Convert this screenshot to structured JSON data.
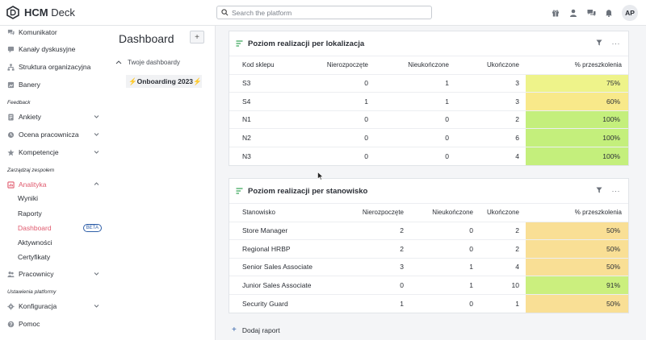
{
  "app": {
    "logo_text_bold": "HCM",
    "logo_text_rest": " Deck"
  },
  "search": {
    "placeholder": "Search the platform"
  },
  "user": {
    "initials": "AP"
  },
  "sidebar": {
    "top_items": [
      {
        "label": "Komunikator",
        "icon": "chat-icon"
      },
      {
        "label": "Kanały dyskusyjne",
        "icon": "channels-icon"
      },
      {
        "label": "Struktura organizacyjna",
        "icon": "org-structure-icon"
      },
      {
        "label": "Banery",
        "icon": "banner-icon"
      }
    ],
    "section_feedback": "Feedback",
    "feedback_items": [
      {
        "label": "Ankiety",
        "icon": "survey-icon"
      },
      {
        "label": "Ocena pracownicza",
        "icon": "evaluation-icon"
      },
      {
        "label": "Kompetencje",
        "icon": "star-icon"
      }
    ],
    "section_team": "Zarządzaj zespołem",
    "analytics": {
      "label": "Analityka",
      "icon": "analytics-icon"
    },
    "analytics_sub": [
      "Wyniki",
      "Raporty",
      "Dashboard",
      "Aktywności",
      "Certyfikaty"
    ],
    "beta_badge": "BETA",
    "employees": {
      "label": "Pracownicy",
      "icon": "people-icon"
    },
    "section_settings": "Ustawienia platformy",
    "config": {
      "label": "Konfiguracja",
      "icon": "gear-icon"
    },
    "help": {
      "label": "Pomoc",
      "icon": "help-icon"
    }
  },
  "dashboard_panel": {
    "title": "Dashboard",
    "add_label": "+",
    "tree_head": "Twoje dashboardy",
    "active_item": "Onboarding 2023"
  },
  "cards": [
    {
      "title": "Poziom realizacji per lokalizacja",
      "columns": [
        "Kod sklepu",
        "Nierozpoczęte",
        "Nieukończone",
        "Ukończone",
        "% przeszkolenia"
      ],
      "rows": [
        {
          "cells": [
            "S3",
            "0",
            "1",
            "3",
            "75%"
          ],
          "color": "#eef38a"
        },
        {
          "cells": [
            "S4",
            "1",
            "1",
            "3",
            "60%"
          ],
          "color": "#f8e98a"
        },
        {
          "cells": [
            "N1",
            "0",
            "0",
            "2",
            "100%"
          ],
          "color": "#c4ef7c"
        },
        {
          "cells": [
            "N2",
            "0",
            "0",
            "6",
            "100%"
          ],
          "color": "#c4ef7c"
        },
        {
          "cells": [
            "N3",
            "0",
            "0",
            "4",
            "100%"
          ],
          "color": "#c4ef7c"
        }
      ]
    },
    {
      "title": "Poziom realizacji per stanowisko",
      "columns": [
        "Stanowisko",
        "Nierozpoczęte",
        "Nieukończone",
        "Ukończone",
        "% przeszkolenia"
      ],
      "rows": [
        {
          "cells": [
            "Store Manager",
            "2",
            "0",
            "2",
            "50%"
          ],
          "color": "#f9df95"
        },
        {
          "cells": [
            "Regional HRBP",
            "2",
            "0",
            "2",
            "50%"
          ],
          "color": "#f9df95"
        },
        {
          "cells": [
            "Senior Sales Associate",
            "3",
            "1",
            "4",
            "50%"
          ],
          "color": "#f9df95"
        },
        {
          "cells": [
            "Junior Sales Associate",
            "0",
            "1",
            "10",
            "91%"
          ],
          "color": "#cbef7e"
        },
        {
          "cells": [
            "Security Guard",
            "1",
            "0",
            "1",
            "50%"
          ],
          "color": "#f9df95"
        }
      ]
    }
  ],
  "add_report": "Dodaj raport"
}
